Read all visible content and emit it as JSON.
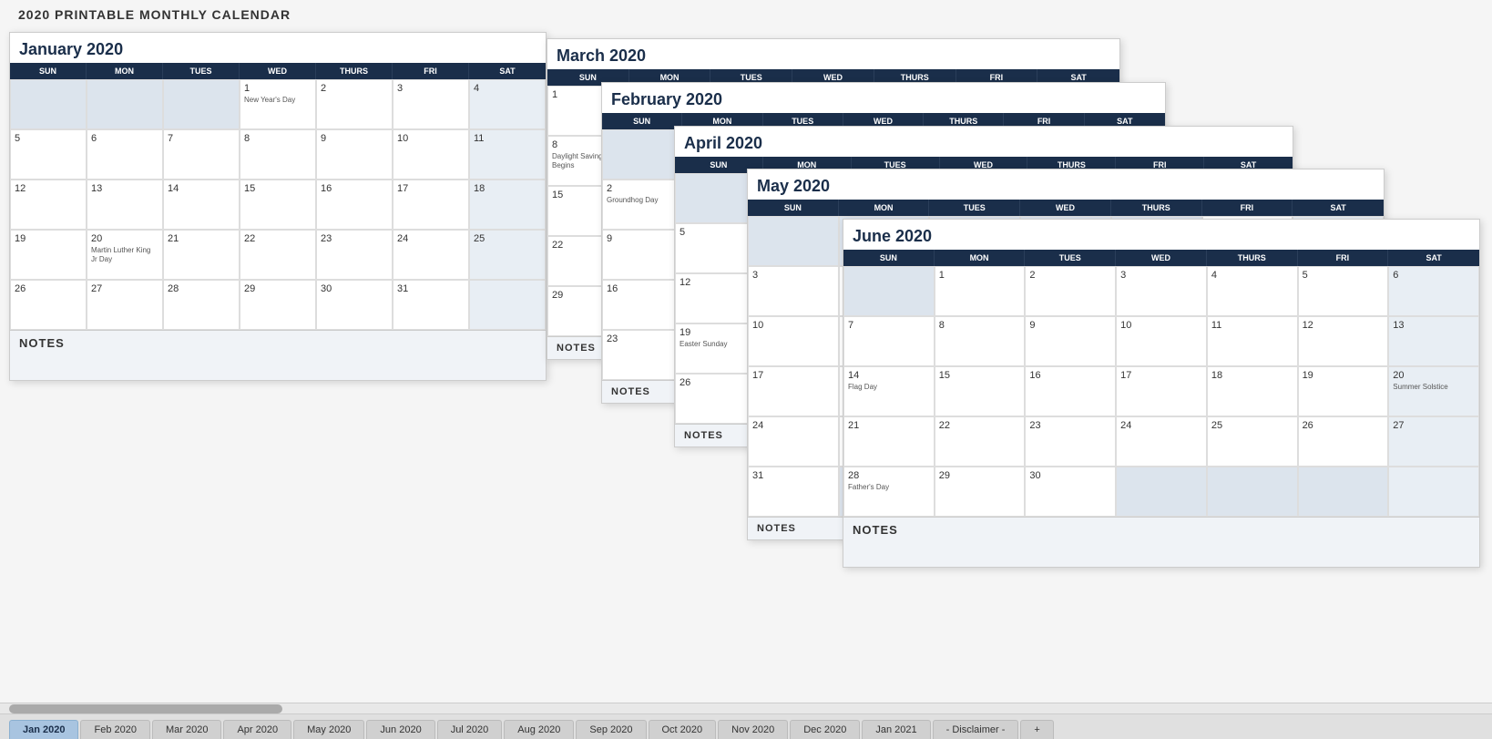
{
  "page": {
    "title": "2020 PRINTABLE MONTHLY CALENDAR"
  },
  "tabs": [
    {
      "label": "Jan 2020",
      "active": true
    },
    {
      "label": "Feb 2020",
      "active": false
    },
    {
      "label": "Mar 2020",
      "active": false
    },
    {
      "label": "Apr 2020",
      "active": false
    },
    {
      "label": "May 2020",
      "active": false
    },
    {
      "label": "Jun 2020",
      "active": false
    },
    {
      "label": "Jul 2020",
      "active": false
    },
    {
      "label": "Aug 2020",
      "active": false
    },
    {
      "label": "Sep 2020",
      "active": false
    },
    {
      "label": "Oct 2020",
      "active": false
    },
    {
      "label": "Nov 2020",
      "active": false
    },
    {
      "label": "Dec 2020",
      "active": false
    },
    {
      "label": "Jan 2021",
      "active": false
    },
    {
      "label": "- Disclaimer -",
      "active": false
    },
    {
      "label": "+",
      "active": false
    }
  ],
  "calendars": {
    "january": {
      "title": "January 2020",
      "headers": [
        "SUN",
        "MON",
        "TUES",
        "WED",
        "THURS",
        "FRI",
        "SAT"
      ],
      "notes_label": "NOTES"
    },
    "february": {
      "title": "February 2020",
      "headers": [
        "SUN",
        "MON",
        "TUES",
        "WED",
        "THURS",
        "FRI",
        "SAT"
      ],
      "notes_label": "NOTES"
    },
    "march": {
      "title": "March 2020",
      "headers": [
        "SUN",
        "MON",
        "TUES",
        "WED",
        "THURS",
        "FRI",
        "SAT"
      ],
      "notes_label": "NOTES"
    },
    "april": {
      "title": "April 2020",
      "headers": [
        "SUN",
        "MON",
        "TUES",
        "WED",
        "THURS",
        "FRI",
        "SAT"
      ],
      "notes_label": "NOTES"
    },
    "may": {
      "title": "May 2020",
      "headers": [
        "SUN",
        "MON",
        "TUES",
        "WED",
        "THURS",
        "FRI",
        "SAT"
      ],
      "notes_label": "NOTES"
    },
    "june": {
      "title": "June 2020",
      "headers": [
        "SUN",
        "MON",
        "TUES",
        "WED",
        "THURS",
        "FRI",
        "SAT"
      ],
      "notes_label": "NOTES"
    }
  }
}
